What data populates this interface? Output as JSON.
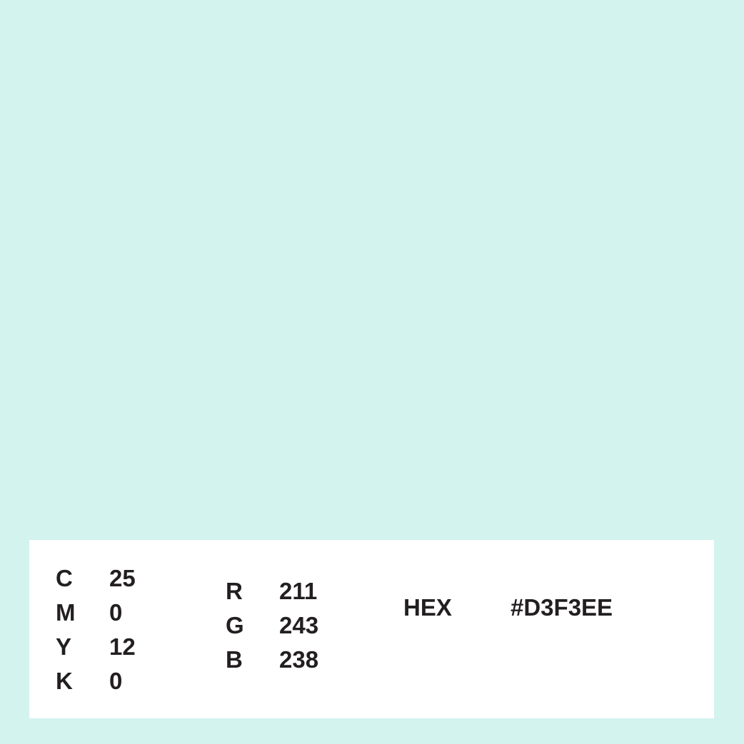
{
  "swatch": {
    "color": "#D3F3EE"
  },
  "cmyk": [
    {
      "label": "C",
      "value": "25"
    },
    {
      "label": "M",
      "value": "0"
    },
    {
      "label": "Y",
      "value": "12"
    },
    {
      "label": "K",
      "value": "0"
    }
  ],
  "rgb": [
    {
      "label": "R",
      "value": "211"
    },
    {
      "label": "G",
      "value": "243"
    },
    {
      "label": "B",
      "value": "238"
    }
  ],
  "hex": {
    "label": "HEX",
    "value": "#D3F3EE"
  }
}
